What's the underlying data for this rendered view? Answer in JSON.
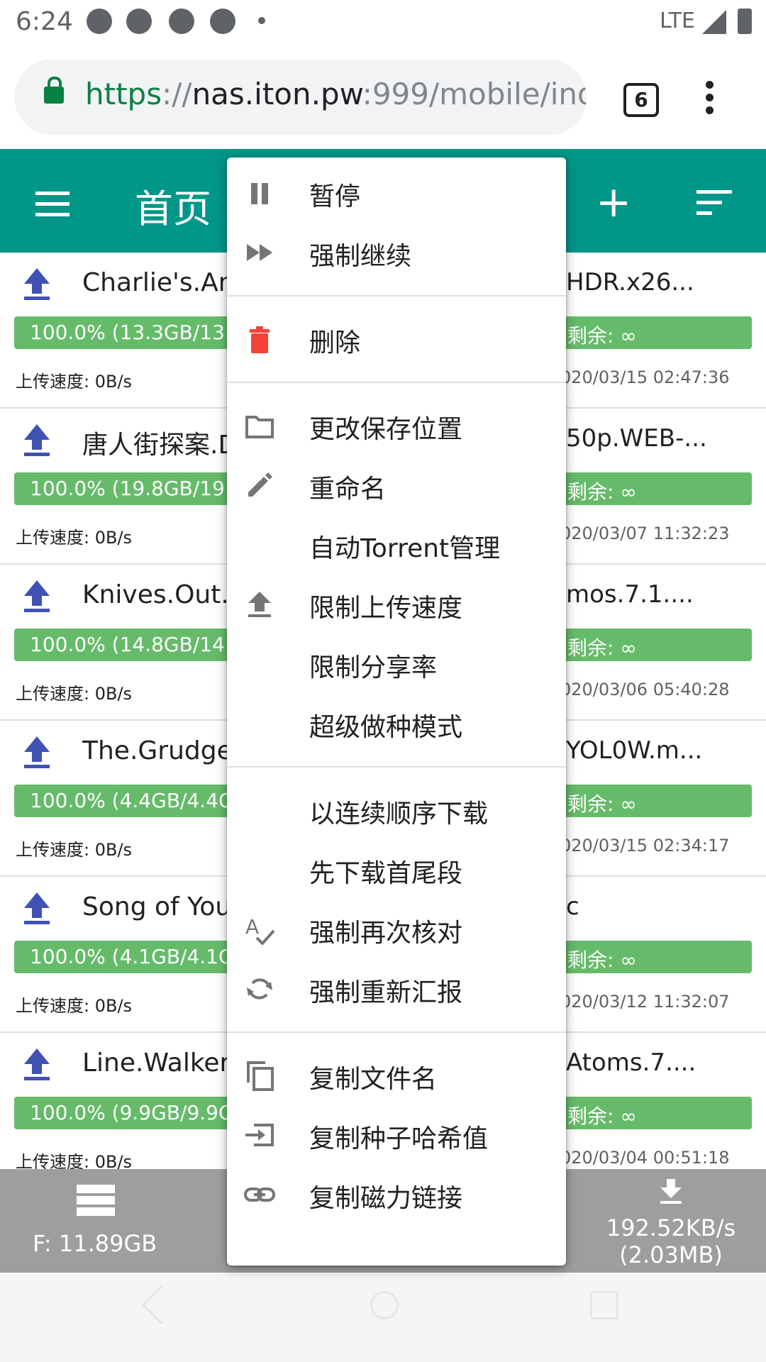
{
  "status_bar": {
    "time": "6:24",
    "network": "LTE"
  },
  "browser": {
    "url_scheme": "https",
    "url_sep": "://",
    "url_host": "nas.iton.pw",
    "url_rest": ":999/mobile/inde",
    "tab_count": "6"
  },
  "toolbar": {
    "title": "首页"
  },
  "torrents": [
    {
      "name": "Charlie's.Ang",
      "name_end": "HDR.x26...",
      "progress": "100.0% (13.3GB/13.3",
      "remaining": "剩余: ∞",
      "upload_speed": "上传速度: 0B/s",
      "date": "020/03/15 02:47:36"
    },
    {
      "name": "唐人街探案.D",
      "name_end": "50p.WEB-...",
      "progress": "100.0% (19.8GB/19.8",
      "remaining": "剩余: ∞",
      "upload_speed": "上传速度: 0B/s",
      "date": "020/03/07 11:32:23"
    },
    {
      "name": "Knives.Out.2",
      "name_end": "mos.7.1....",
      "progress": "100.0% (14.8GB/14.8",
      "remaining": "剩余: ∞",
      "upload_speed": "上传速度: 0B/s",
      "date": "020/03/06 05:40:28"
    },
    {
      "name": "The.Grudge.2",
      "name_end": "YOL0W.m...",
      "progress": "100.0% (4.4GB/4.4GB",
      "remaining": "剩余: ∞",
      "upload_speed": "上传速度: 0B/s",
      "date": "020/03/15 02:34:17"
    },
    {
      "name": "Song of Yout",
      "name_end": "c",
      "progress": "100.0% (4.1GB/4.1GB",
      "remaining": "剩余: ∞",
      "upload_speed": "上传速度: 0B/s",
      "date": "020/03/12 11:32:07"
    },
    {
      "name": "Line.Walker.2",
      "name_end": "Atoms.7....",
      "progress": "100.0% (9.9GB/9.9GB",
      "remaining": "剩余: ∞",
      "upload_speed": "上传速度: 0B/s",
      "date": "020/03/04 00:51:18"
    }
  ],
  "footer": {
    "free_space": "F: 11.89GB",
    "download_speed": "192.52KB/s",
    "download_total": "(2.03MB)"
  },
  "context_menu": {
    "groups": [
      [
        {
          "label": "暂停",
          "icon": "pause-icon"
        },
        {
          "label": "强制继续",
          "icon": "fast-forward-icon"
        }
      ],
      [
        {
          "label": "删除",
          "icon": "delete-icon"
        }
      ],
      [
        {
          "label": "更改保存位置",
          "icon": "folder-icon"
        },
        {
          "label": "重命名",
          "icon": "pencil-icon"
        },
        {
          "label": "自动Torrent管理",
          "icon": ""
        },
        {
          "label": "限制上传速度",
          "icon": "upload-icon"
        },
        {
          "label": "限制分享率",
          "icon": ""
        },
        {
          "label": "超级做种模式",
          "icon": ""
        }
      ],
      [
        {
          "label": "以连续顺序下载",
          "icon": ""
        },
        {
          "label": "先下载首尾段",
          "icon": ""
        },
        {
          "label": "强制再次核对",
          "icon": "spellcheck-icon"
        },
        {
          "label": "强制重新汇报",
          "icon": "refresh-icon"
        }
      ],
      [
        {
          "label": "复制文件名",
          "icon": "copy-icon"
        },
        {
          "label": "复制种子哈希值",
          "icon": "input-icon"
        },
        {
          "label": "复制磁力链接",
          "icon": "link-icon"
        }
      ]
    ]
  },
  "colors": {
    "toolbar": "#009688",
    "progress": "#66bb6a",
    "footer": "#9e9e9e",
    "delete": "#f44336",
    "upload_arrow": "#3f51b5"
  }
}
